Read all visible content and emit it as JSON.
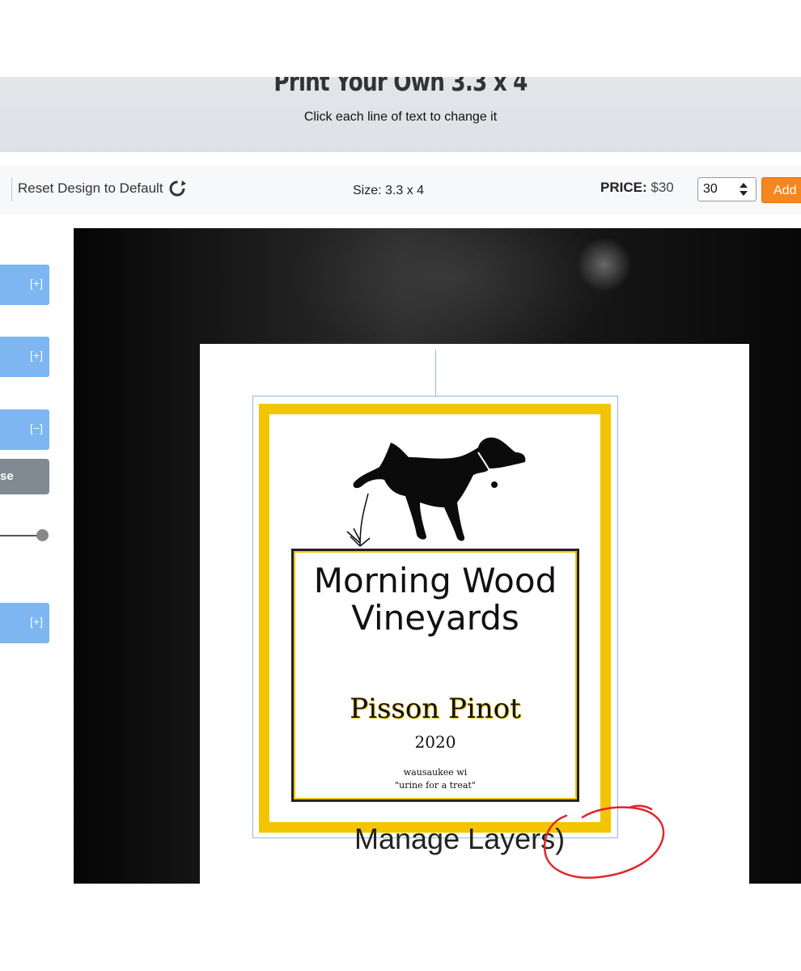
{
  "header": {
    "title": "Print Your Own 3.3 x 4",
    "subtitle": "Click each line of text to change it"
  },
  "toolbar": {
    "reset_label": "Reset Design to Default",
    "size_text": "Size: 3.3 x 4",
    "price_label": "PRICE:",
    "price_value": "$30",
    "quantity": "30",
    "add_label": "Add"
  },
  "left_panel": {
    "sections": [
      {
        "toggle": "[+]"
      },
      {
        "toggle": "[+]"
      },
      {
        "toggle": "[−]"
      },
      {
        "toggle": "[+]"
      }
    ],
    "browse_label": "se",
    "slider_level": 1.0
  },
  "label": {
    "vineyard_line1": "Morning Wood",
    "vineyard_line2": "Vineyards",
    "wine_name": "Pisson Pinot",
    "year": "2020",
    "location": "wausaukee wi",
    "tagline": "\"urine for a treat\""
  },
  "canvas_overlay_text": "Manage Layers)",
  "colors": {
    "accent_blue": "#7db6f0",
    "add_orange": "#f6861f",
    "label_gold": "#f2c500",
    "annotation_red": "#e0262b"
  },
  "icons": {
    "reset": "refresh-icon",
    "quantity_spinner": "spinner-arrows-icon",
    "label_art": "dog-silhouette-icon"
  }
}
